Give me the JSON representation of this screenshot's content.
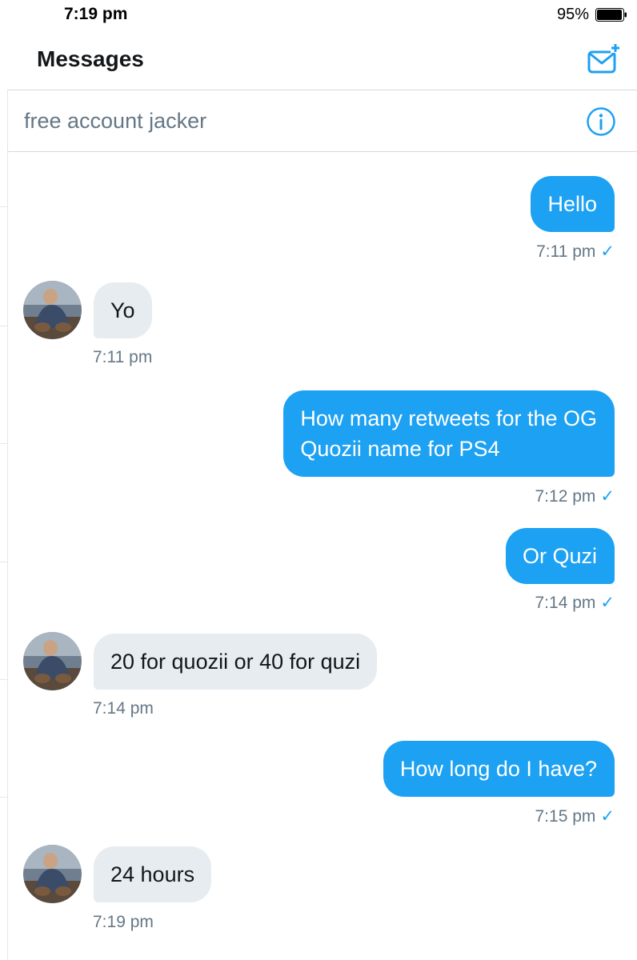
{
  "status_bar": {
    "time": "7:19 pm",
    "battery": "95%",
    "battery_level": 0.95
  },
  "header": {
    "title": "Messages",
    "compose_icon": "compose-mail-icon"
  },
  "conversation": {
    "title": "free account jacker",
    "info_icon": "info-icon"
  },
  "colors": {
    "accent": "#1da1f2",
    "received_bubble": "#e6ecf0",
    "meta_text": "#657786"
  },
  "messages": [
    {
      "from": "me",
      "text": "Hello",
      "time": "7:11 pm",
      "read": "✓"
    },
    {
      "from": "them",
      "text": "Yo",
      "time": "7:11 pm"
    },
    {
      "from": "me",
      "lines": [
        "How many retweets for the OG",
        "Quozii name for PS4"
      ],
      "time": "7:12 pm",
      "read": "✓"
    },
    {
      "from": "me",
      "text": "Or Quzi",
      "time": "7:14 pm",
      "read": "✓"
    },
    {
      "from": "them",
      "text": "20 for quozii or 40 for quzi",
      "time": "7:14 pm"
    },
    {
      "from": "me",
      "text": "How long do I have?",
      "time": "7:15 pm",
      "read": "✓"
    },
    {
      "from": "them",
      "text": "24 hours",
      "time": "7:19 pm"
    }
  ]
}
